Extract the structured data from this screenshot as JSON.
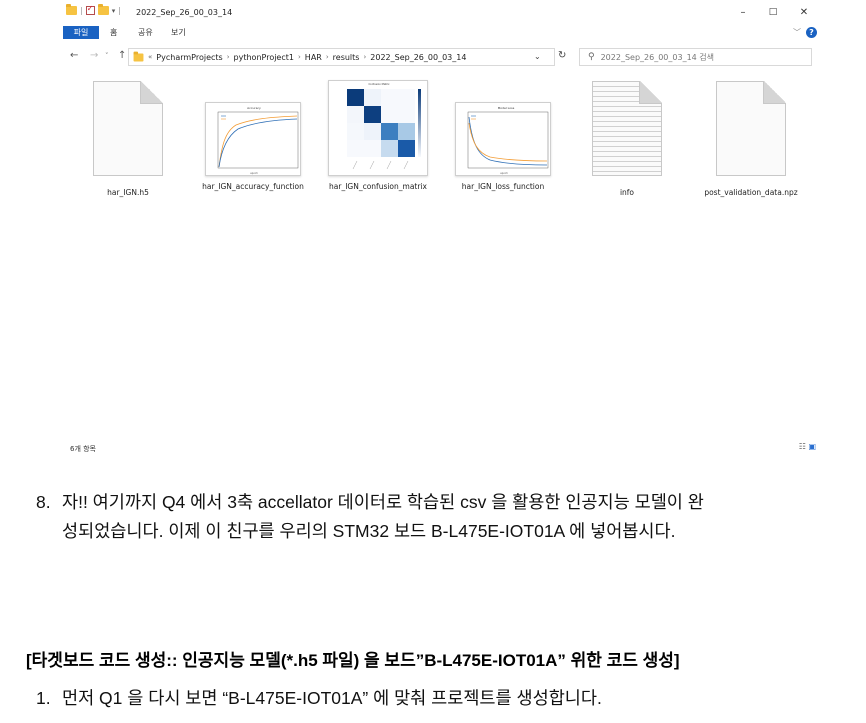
{
  "titlebar": {
    "title": "2022_Sep_26_00_03_14",
    "minimize": "–",
    "maximize": "□",
    "close": "✕"
  },
  "ribbon": {
    "tabs": [
      "파일",
      "홈",
      "공유",
      "보기"
    ],
    "help": "?"
  },
  "nav": {
    "back": "←",
    "forward": "→",
    "up": "↑",
    "overflow": "«",
    "breadcrumb": [
      "PycharmProjects",
      "pythonProject1",
      "HAR",
      "results",
      "2022_Sep_26_00_03_14"
    ],
    "search_placeholder": "2022_Sep_26_00_03_14 검색"
  },
  "files": [
    {
      "name": "har_IGN.h5",
      "kind": "blank"
    },
    {
      "name": "har_IGN_accuracy_function",
      "kind": "accuracy"
    },
    {
      "name": "har_IGN_confusion_matrix",
      "kind": "confusion"
    },
    {
      "name": "har_IGN_loss_function",
      "kind": "loss"
    },
    {
      "name": "info",
      "kind": "text"
    },
    {
      "name": "post_validation_data.npz",
      "kind": "blank"
    }
  ],
  "status": {
    "count": "6개 항목"
  },
  "doc": {
    "item8_num": "8.",
    "item8_line1": "자!! 여기까지 Q4 에서 3축 accellator 데이터로 학습된 csv 을 활용한 인공지능 모델이 완",
    "item8_line2": "성되었습니다. 이제 이 친구를 우리의 STM32 보드 B-L475E-IOT01A 에 넣어봅시다.",
    "heading": "[타겟보드 코드 생성:: 인공지능 모델(*.h5 파일) 을 보드”B-L475E-IOT01A” 위한 코드 생성]",
    "item1_num": "1.",
    "item1_line": "먼저 Q1 을 다시 보면 “B-L475E-IOT01A” 에 맞춰 프로젝트를 생성합니다."
  },
  "colors": {
    "accent": "#1a62c2",
    "folder": "#f6c342",
    "train": "#2f6fb6",
    "validation": "#f39c34",
    "cm_dark": "#0b3b7a"
  }
}
